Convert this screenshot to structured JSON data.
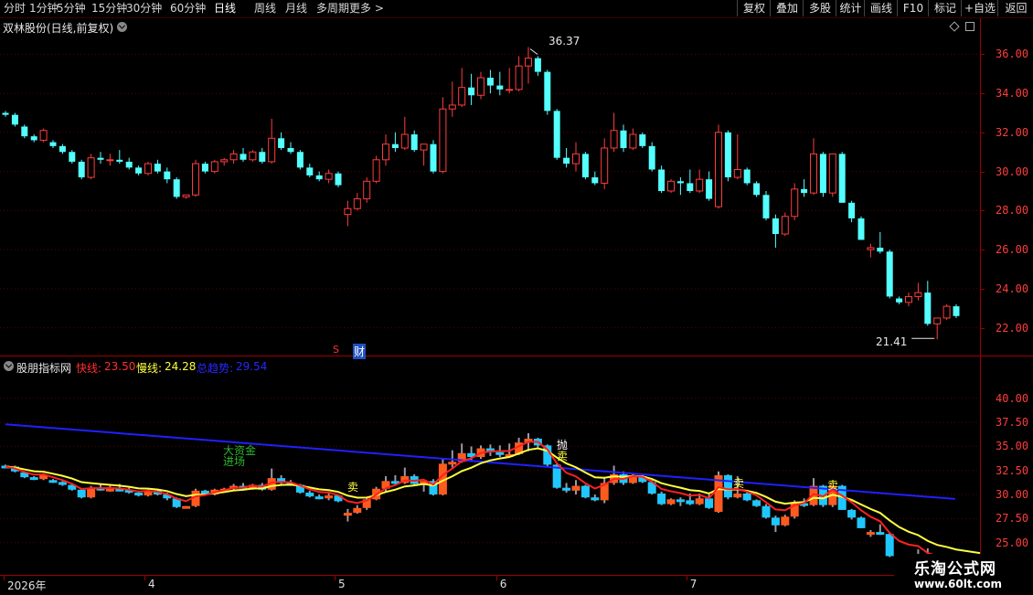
{
  "toolbar": {
    "periods": [
      "分时",
      "1分钟",
      "5分钟",
      "15分钟",
      "30分钟",
      "60分钟",
      "日线",
      "周线",
      "月线",
      "多周期",
      "更多"
    ],
    "active_period": "日线",
    "right_buttons": [
      "复权",
      "叠加",
      "多股",
      "统计",
      "画线",
      "F10",
      "标记",
      "+自选",
      "返回"
    ]
  },
  "main_chart": {
    "title": "双林股份(日线,前复权)",
    "high_label": "36.37",
    "low_label": "21.41",
    "event_tag": "财",
    "event_marker": "S"
  },
  "indicator": {
    "name": "股朋指标网",
    "fast_label": "快线:",
    "fast_value": "23.50",
    "slow_label": "慢线:",
    "slow_value": "24.28",
    "trend_label": "总趋势:",
    "trend_value": "29.54",
    "annotations": {
      "big_fund": "大资金",
      "enter": "进场",
      "throw": "抛",
      "sell": "卖"
    }
  },
  "x_axis": {
    "labels": [
      {
        "text": "2026年",
        "index": 0
      },
      {
        "text": "4",
        "index": 15
      },
      {
        "text": "5",
        "index": 35
      },
      {
        "text": "6",
        "index": 52
      },
      {
        "text": "7",
        "index": 72
      }
    ]
  },
  "branding": {
    "site_name": "乐淘公式网",
    "site_url": "www.60lt.com"
  },
  "colors": {
    "up": "#ff3c3c",
    "down": "#54ffff",
    "fast": "#ff2020",
    "slow": "#ffff40",
    "trend": "#2020ff",
    "axis": "#9b0000"
  },
  "chart_data": {
    "type": "candlestick",
    "y_axis_main": {
      "min": 21,
      "max": 37,
      "ticks": [
        22,
        24,
        26,
        28,
        30,
        32,
        34,
        36
      ]
    },
    "y_axis_indicator": {
      "ticks": [
        25.0,
        27.5,
        30.0,
        32.5,
        35.0,
        37.5,
        40.0
      ]
    },
    "ohlc": [
      [
        33.0,
        33.1,
        32.8,
        32.9
      ],
      [
        32.9,
        33.0,
        32.3,
        32.4
      ],
      [
        32.3,
        32.4,
        31.7,
        31.8
      ],
      [
        31.8,
        31.9,
        31.5,
        31.6
      ],
      [
        31.6,
        32.2,
        31.5,
        32.1
      ],
      [
        31.5,
        31.6,
        31.2,
        31.3
      ],
      [
        31.3,
        31.4,
        30.9,
        31.0
      ],
      [
        31.0,
        31.1,
        30.4,
        30.5
      ],
      [
        30.5,
        30.6,
        29.6,
        29.7
      ],
      [
        29.7,
        30.9,
        29.6,
        30.7
      ],
      [
        30.7,
        31.0,
        30.4,
        30.6
      ],
      [
        30.6,
        30.9,
        30.3,
        30.6
      ],
      [
        30.6,
        31.1,
        30.4,
        30.5
      ],
      [
        30.5,
        30.7,
        30.1,
        30.2
      ],
      [
        30.2,
        30.3,
        29.8,
        29.9
      ],
      [
        29.9,
        30.5,
        29.8,
        30.4
      ],
      [
        30.4,
        30.6,
        29.9,
        30.0
      ],
      [
        30.0,
        30.2,
        29.4,
        29.6
      ],
      [
        29.6,
        29.7,
        28.6,
        28.7
      ],
      [
        28.7,
        28.8,
        28.6,
        28.8
      ],
      [
        28.8,
        30.6,
        28.7,
        30.4
      ],
      [
        30.4,
        30.5,
        29.9,
        30.0
      ],
      [
        30.0,
        30.6,
        29.9,
        30.5
      ],
      [
        30.5,
        30.7,
        30.3,
        30.6
      ],
      [
        30.6,
        31.1,
        30.4,
        30.9
      ],
      [
        30.9,
        31.2,
        30.5,
        30.6
      ],
      [
        30.6,
        31.1,
        30.5,
        31.0
      ],
      [
        31.0,
        31.2,
        30.4,
        30.5
      ],
      [
        30.5,
        32.7,
        30.4,
        31.7
      ],
      [
        31.7,
        32.0,
        31.1,
        31.2
      ],
      [
        31.2,
        31.5,
        30.9,
        31.0
      ],
      [
        31.0,
        31.1,
        30.1,
        30.2
      ],
      [
        30.2,
        30.4,
        29.7,
        29.8
      ],
      [
        29.8,
        30.0,
        29.5,
        29.6
      ],
      [
        29.6,
        30.1,
        29.4,
        29.9
      ],
      [
        29.9,
        30.0,
        29.2,
        29.3
      ],
      [
        27.8,
        28.5,
        27.2,
        28.1
      ],
      [
        28.1,
        28.9,
        28.0,
        28.6
      ],
      [
        28.6,
        29.7,
        28.4,
        29.5
      ],
      [
        29.5,
        30.8,
        29.4,
        30.6
      ],
      [
        30.6,
        31.9,
        30.3,
        31.4
      ],
      [
        31.4,
        32.0,
        31.0,
        31.2
      ],
      [
        31.2,
        32.8,
        31.1,
        31.9
      ],
      [
        31.9,
        32.1,
        31.0,
        31.1
      ],
      [
        31.1,
        31.3,
        30.3,
        31.4
      ],
      [
        31.4,
        31.6,
        29.9,
        30.0
      ],
      [
        30.0,
        33.8,
        29.9,
        33.2
      ],
      [
        33.2,
        34.6,
        32.8,
        33.4
      ],
      [
        33.4,
        35.3,
        33.3,
        34.3
      ],
      [
        34.3,
        35.0,
        33.4,
        33.9
      ],
      [
        33.9,
        35.1,
        33.7,
        34.8
      ],
      [
        34.8,
        35.2,
        34.0,
        34.4
      ],
      [
        34.4,
        35.1,
        33.9,
        34.2
      ],
      [
        34.2,
        35.3,
        34.0,
        34.2
      ],
      [
        34.2,
        35.9,
        34.1,
        35.4
      ],
      [
        35.4,
        36.37,
        34.5,
        35.8
      ],
      [
        35.8,
        35.9,
        34.9,
        35.1
      ],
      [
        35.1,
        35.2,
        32.9,
        33.1
      ],
      [
        33.1,
        33.2,
        30.6,
        30.7
      ],
      [
        30.7,
        31.2,
        30.2,
        30.4
      ],
      [
        30.4,
        31.5,
        30.0,
        30.9
      ],
      [
        30.9,
        31.0,
        29.6,
        29.7
      ],
      [
        29.7,
        30.0,
        29.3,
        29.4
      ],
      [
        29.4,
        31.7,
        29.1,
        31.2
      ],
      [
        31.2,
        33.0,
        31.0,
        32.1
      ],
      [
        32.1,
        32.4,
        31.0,
        31.2
      ],
      [
        31.2,
        32.2,
        31.1,
        31.9
      ],
      [
        31.9,
        32.0,
        31.2,
        31.3
      ],
      [
        31.3,
        31.5,
        30.0,
        30.1
      ],
      [
        30.1,
        30.3,
        28.9,
        29.0
      ],
      [
        29.0,
        29.6,
        28.9,
        29.5
      ],
      [
        29.5,
        29.7,
        28.8,
        29.4
      ],
      [
        29.4,
        30.1,
        28.9,
        29.0
      ],
      [
        29.0,
        30.1,
        28.9,
        29.6
      ],
      [
        29.6,
        30.0,
        28.5,
        28.6
      ],
      [
        28.2,
        32.4,
        28.1,
        32.0
      ],
      [
        32.0,
        32.1,
        29.5,
        29.7
      ],
      [
        29.7,
        31.9,
        29.6,
        30.1
      ],
      [
        30.1,
        30.2,
        29.3,
        29.4
      ],
      [
        29.4,
        29.5,
        28.7,
        28.8
      ],
      [
        28.8,
        29.0,
        27.5,
        27.6
      ],
      [
        27.6,
        27.8,
        26.1,
        26.8
      ],
      [
        26.8,
        27.9,
        26.7,
        27.7
      ],
      [
        27.7,
        29.4,
        27.5,
        29.1
      ],
      [
        29.1,
        29.6,
        28.7,
        28.9
      ],
      [
        28.9,
        31.7,
        28.8,
        30.9
      ],
      [
        30.9,
        31.0,
        28.7,
        28.9
      ],
      [
        28.9,
        30.9,
        28.7,
        30.9
      ],
      [
        30.9,
        31.0,
        28.4,
        28.4
      ],
      [
        28.4,
        28.5,
        27.4,
        27.6
      ],
      [
        27.6,
        27.7,
        26.5,
        26.5
      ],
      [
        26.0,
        26.3,
        25.6,
        26.1
      ],
      [
        26.1,
        26.9,
        25.8,
        25.9
      ],
      [
        25.9,
        26.0,
        23.5,
        23.6
      ],
      [
        23.5,
        23.6,
        23.2,
        23.3
      ],
      [
        23.3,
        23.8,
        23.1,
        23.6
      ],
      [
        23.6,
        24.3,
        23.4,
        23.8
      ],
      [
        23.8,
        24.4,
        22.1,
        22.2
      ],
      [
        22.2,
        22.3,
        21.41,
        22.5
      ],
      [
        22.5,
        23.2,
        22.4,
        23.1
      ],
      [
        23.1,
        23.2,
        22.5,
        22.6
      ]
    ],
    "trend_line": [
      [
        0,
        37.3
      ],
      [
        97,
        29.54
      ]
    ],
    "fast_line_end": 23.5,
    "slow_line_end": 24.28
  }
}
